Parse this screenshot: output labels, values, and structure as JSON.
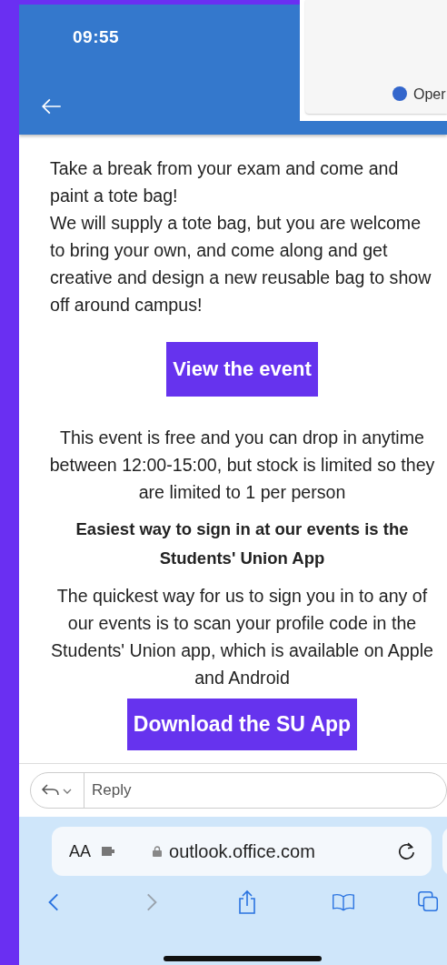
{
  "status_bar": {
    "time": "09:55"
  },
  "overlay_card": {
    "legend": {
      "label": "Oper",
      "color": "#3366cc"
    }
  },
  "email_body": [
    {
      "kind": "intro",
      "text": "Take a break from your exam and come and paint a tote bag!\nWe will supply a tote bag, but you are welcome to bring your own, and come along and get creative and design a new reusable bag to show off around campus!"
    },
    {
      "kind": "button",
      "text": "View the event"
    },
    {
      "kind": "paragraph",
      "text": "This event is free and you can drop in anytime between 12:00-15:00, but stock is limited so they are limited to 1 per person"
    },
    {
      "kind": "heading",
      "text": "Easiest way to sign in at our events is the Students' Union App"
    },
    {
      "kind": "paragraph",
      "text": "The quickest way for us to sign you in to any of our events is to scan your profile code in the Students' Union app, which is available on Apple and Android"
    },
    {
      "kind": "button",
      "text": "Download the SU App"
    }
  ],
  "reply_bar": {
    "placeholder": "Reply"
  },
  "browser": {
    "text_size": "AA",
    "url": "outlook.office.com",
    "back_disabled": false,
    "forward_disabled": true
  }
}
